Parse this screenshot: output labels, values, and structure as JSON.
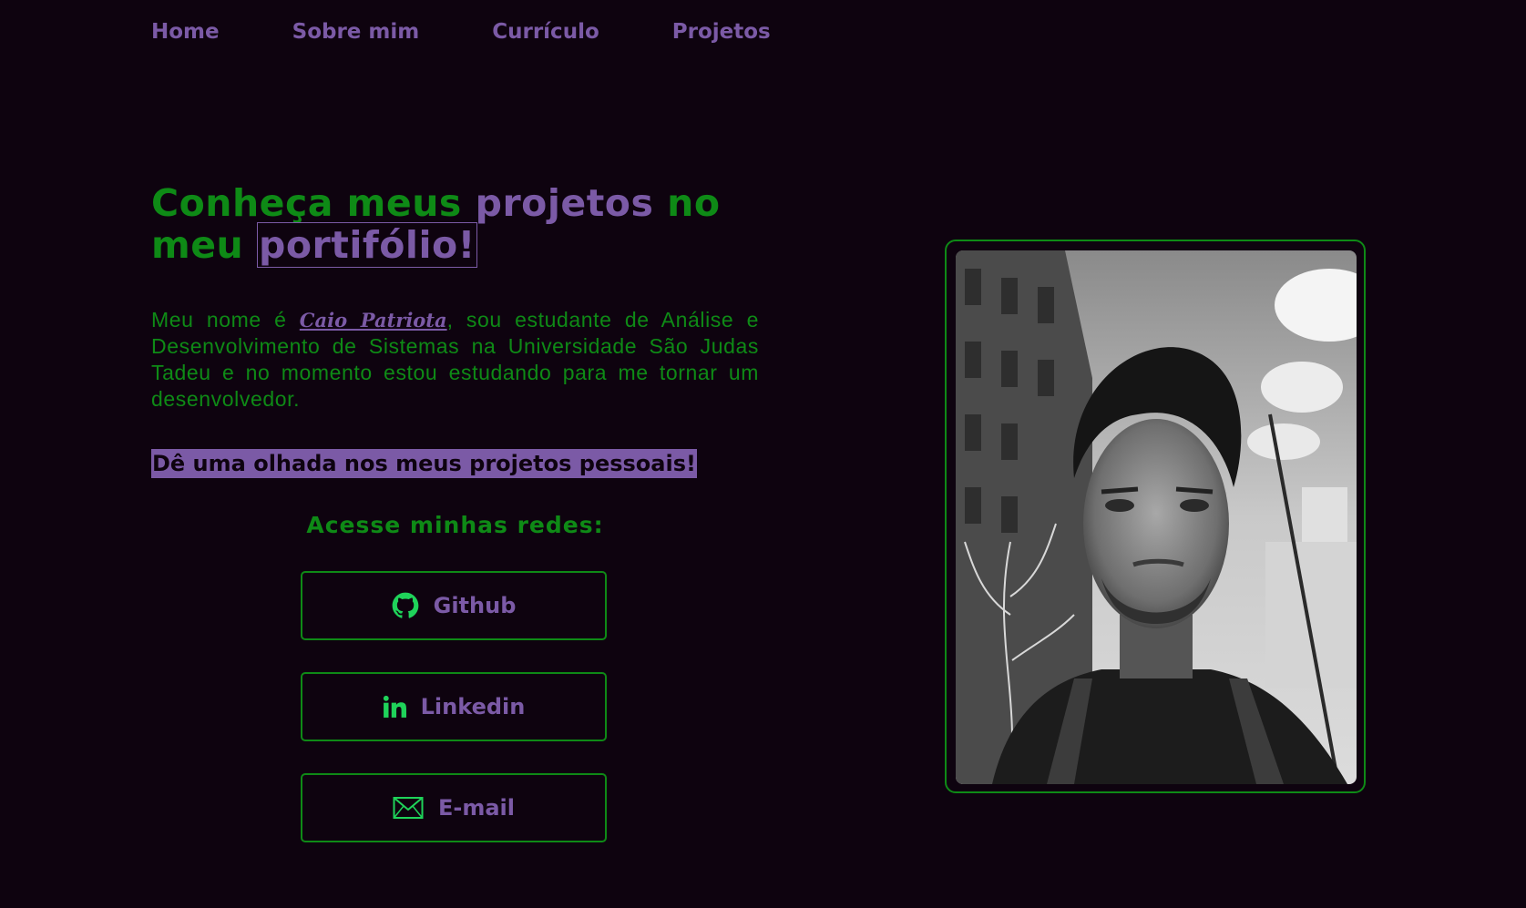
{
  "nav": {
    "items": [
      {
        "label": "Home"
      },
      {
        "label": "Sobre mim"
      },
      {
        "label": "Currículo"
      },
      {
        "label": "Projetos"
      }
    ]
  },
  "hero": {
    "title_part1": "Conheça meus ",
    "title_part2": "projetos",
    "title_part3": " no meu ",
    "title_part4": "portifólio!",
    "intro_before": "Meu nome é ",
    "intro_name": "Caio Patriota",
    "intro_after": ", sou estudante de Análise e Desenvolvimento de Sistemas na Universidade São Judas Tadeu e no momento estou estudando para me tornar um desenvolvedor.",
    "highlight": "Dê uma olhada nos meus projetos pessoais!"
  },
  "socials": {
    "title": "Acesse minhas redes:",
    "buttons": [
      {
        "label": "Github",
        "icon": "github-icon"
      },
      {
        "label": "Linkedin",
        "icon": "linkedin-icon"
      },
      {
        "label": "E-mail",
        "icon": "mail-icon"
      }
    ]
  },
  "colors": {
    "background": "#0e030f",
    "green": "#0e8a16",
    "purple": "#7b5aa6",
    "icon_green": "#1fd35a"
  }
}
